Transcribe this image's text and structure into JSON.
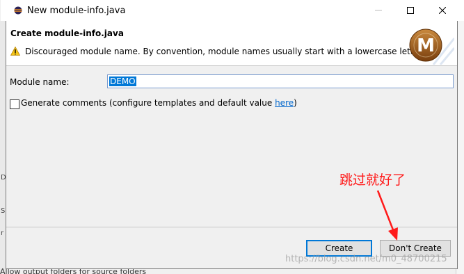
{
  "window": {
    "title": "New module-info.java",
    "minimize_icon": "minimize-icon",
    "maximize_icon": "maximize-icon",
    "close_icon": "close-icon"
  },
  "banner": {
    "title": "Create module-info.java",
    "warning_icon": "warning-icon",
    "warning_message": "Discouraged module name. By convention, module names usually start with a lowercase letter",
    "logo_letter": "M"
  },
  "form": {
    "module_name_label": "Module name:",
    "module_name_value": "DEMO",
    "generate_comments_label": "Generate comments (configure templates and default value ",
    "generate_comments_link": "here",
    "generate_comments_suffix": ")",
    "generate_comments_checked": false
  },
  "buttons": {
    "create": "Create",
    "dont_create": "Don't Create"
  },
  "annotation": {
    "text": "跳过就好了",
    "color": "#ff1a1a"
  },
  "background": {
    "bottom_text": "Allow output folders for source folders",
    "left_letters": [
      "D",
      "S",
      "r"
    ]
  },
  "watermark": "https://blog.csdn.net/m0_48700215",
  "colors": {
    "accent": "#0078d7",
    "link": "#0066cc",
    "logo": "#9a5a1e"
  }
}
